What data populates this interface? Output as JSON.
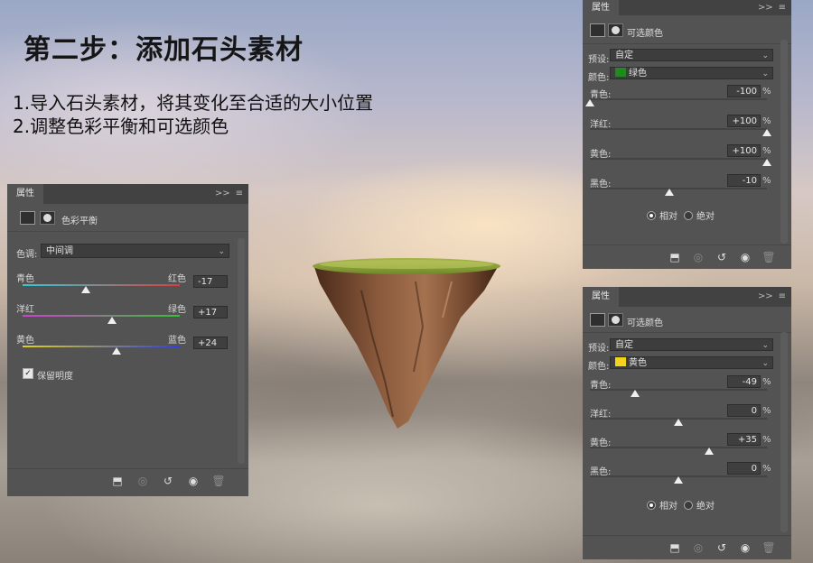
{
  "heading": "第二步：添加石头素材",
  "steps": [
    "1.导入石头素材，将其变化至合适的大小位置",
    "2.调整色彩平衡和可选颜色"
  ],
  "panels": {
    "menu_glyph": ">>",
    "hamburger": "≡",
    "color_balance": {
      "tab": "属性",
      "title": "色彩平衡",
      "tone_label": "色调:",
      "tone_value": "中间调",
      "sliders": [
        {
          "left": "青色",
          "right": "红色",
          "value": "-17",
          "pos": 0.4
        },
        {
          "left": "洋红",
          "right": "绿色",
          "value": "+17",
          "pos": 0.57
        },
        {
          "left": "黄色",
          "right": "蓝色",
          "value": "+24",
          "pos": 0.6
        }
      ],
      "preserve_label": "保留明度",
      "preserve_checked": true
    },
    "selective_green": {
      "tab": "属性",
      "title": "可选颜色",
      "preset_label": "预设:",
      "preset_value": "自定",
      "color_label": "颜色:",
      "color_value": "绿色",
      "color_swatch": "#1f8a1f",
      "sliders": [
        {
          "label": "青色:",
          "value": "-100",
          "pos": 0.0
        },
        {
          "label": "洋红:",
          "value": "+100",
          "pos": 1.0
        },
        {
          "label": "黄色:",
          "value": "+100",
          "pos": 1.0
        },
        {
          "label": "黑色:",
          "value": "-10",
          "pos": 0.45
        }
      ],
      "pct": "%",
      "relative_label": "相对",
      "absolute_label": "绝对",
      "mode": "relative"
    },
    "selective_yellow": {
      "tab": "属性",
      "title": "可选颜色",
      "preset_label": "预设:",
      "preset_value": "自定",
      "color_label": "颜色:",
      "color_value": "黄色",
      "color_swatch": "#f5d31a",
      "sliders": [
        {
          "label": "青色:",
          "value": "-49",
          "pos": 0.255
        },
        {
          "label": "洋红:",
          "value": "0",
          "pos": 0.5
        },
        {
          "label": "黄色:",
          "value": "+35",
          "pos": 0.675
        },
        {
          "label": "黑色:",
          "value": "0",
          "pos": 0.5
        }
      ],
      "pct": "%",
      "relative_label": "相对",
      "absolute_label": "绝对",
      "mode": "relative"
    }
  },
  "colors": {
    "panel_bg": "#535353",
    "tab_bar": "#424242"
  }
}
